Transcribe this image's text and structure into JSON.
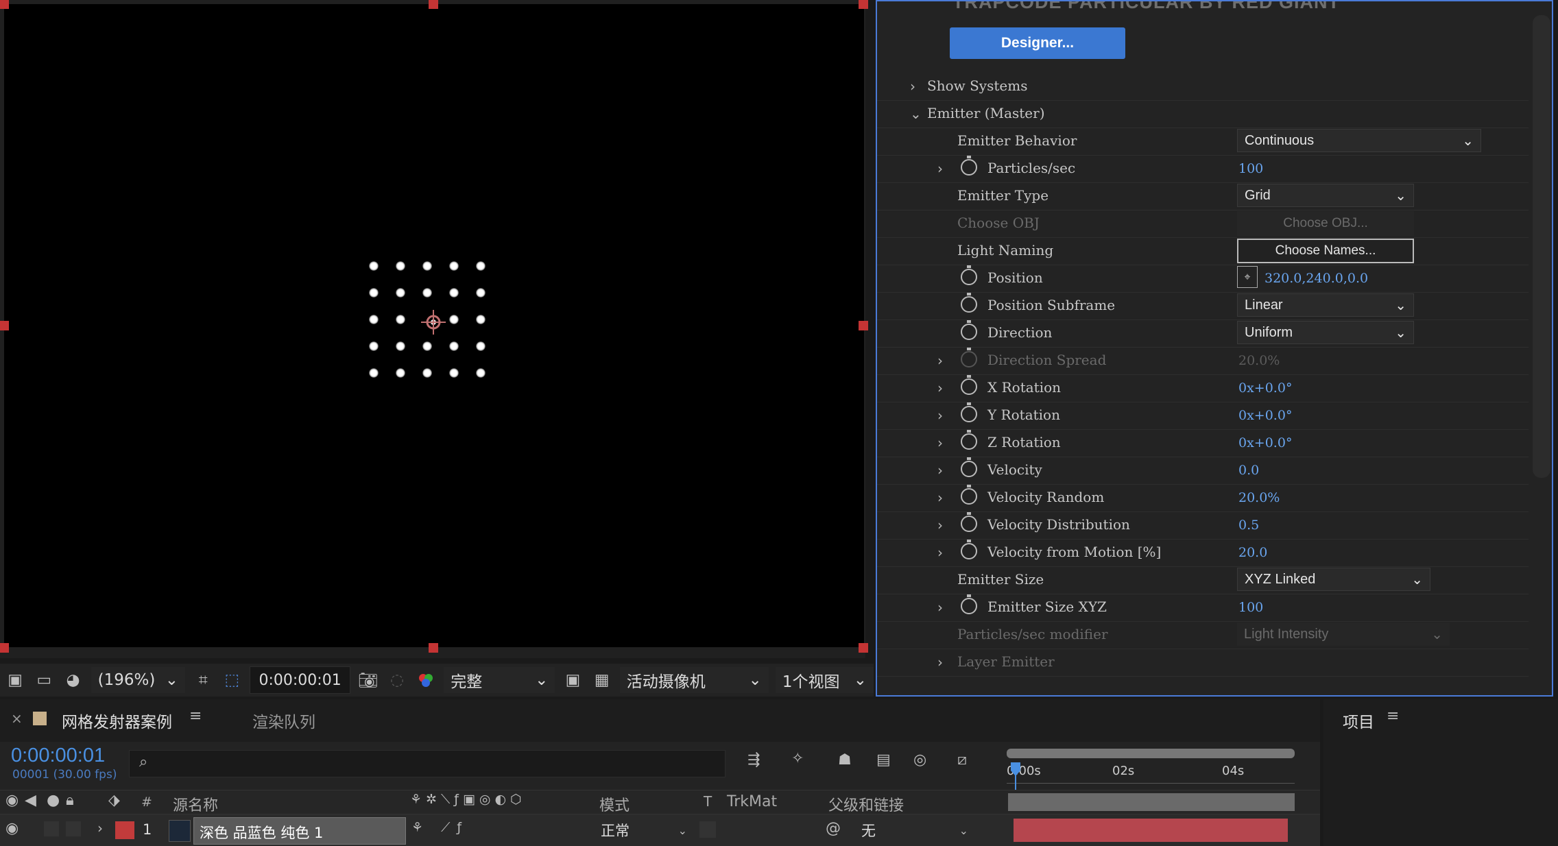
{
  "viewer": {
    "zoom": "(196%)",
    "timecode": "0:00:00:01",
    "resolution": "完整",
    "camera": "活动摄像机",
    "views": "1个视图"
  },
  "effects": {
    "title": "TRAPCODE PARTICULAR BY RED GIANT",
    "designer_label": "Designer...",
    "rows": [
      {
        "label": "Show Systems"
      },
      {
        "label": "Emitter (Master)"
      },
      {
        "label": "Emitter Behavior",
        "value": "Continuous"
      },
      {
        "label": "Particles/sec",
        "value": "100"
      },
      {
        "label": "Emitter Type",
        "value": "Grid"
      },
      {
        "label": "Choose OBJ",
        "value": "Choose OBJ..."
      },
      {
        "label": "Light Naming",
        "value": "Choose Names..."
      },
      {
        "label": "Position",
        "value": "320.0,240.0,0.0"
      },
      {
        "label": "Position Subframe",
        "value": "Linear"
      },
      {
        "label": "Direction",
        "value": "Uniform"
      },
      {
        "label": "Direction Spread",
        "value": "20.0%"
      },
      {
        "label": "X Rotation",
        "value": "0x+0.0°"
      },
      {
        "label": "Y Rotation",
        "value": "0x+0.0°"
      },
      {
        "label": "Z Rotation",
        "value": "0x+0.0°"
      },
      {
        "label": "Velocity",
        "value": "0.0"
      },
      {
        "label": "Velocity Random",
        "value": "20.0%"
      },
      {
        "label": "Velocity Distribution",
        "value": "0.5"
      },
      {
        "label": "Velocity from Motion [%]",
        "value": "20.0"
      },
      {
        "label": "Emitter Size",
        "value": "XYZ Linked"
      },
      {
        "label": "Emitter Size XYZ",
        "value": "100"
      },
      {
        "label": "Particles/sec modifier",
        "value": "Light Intensity"
      },
      {
        "label": "Layer Emitter"
      }
    ]
  },
  "timeline": {
    "comp_tab": "网格发射器案例",
    "render_tab": "渲染队列",
    "timecode": "0:00:00:01",
    "frame_info": "00001 (30.00 fps)",
    "ruler": [
      "0:00s",
      "02s",
      "04s"
    ],
    "col_hash": "#",
    "col_source": "源名称",
    "col_mode": "模式",
    "col_t": "T",
    "col_trkmat": "TrkMat",
    "col_parent": "父级和链接",
    "layer": {
      "num": "1",
      "name": "深色 品蓝色 纯色 1",
      "mode": "正常",
      "parent": "无"
    }
  },
  "project": {
    "title": "项目"
  }
}
